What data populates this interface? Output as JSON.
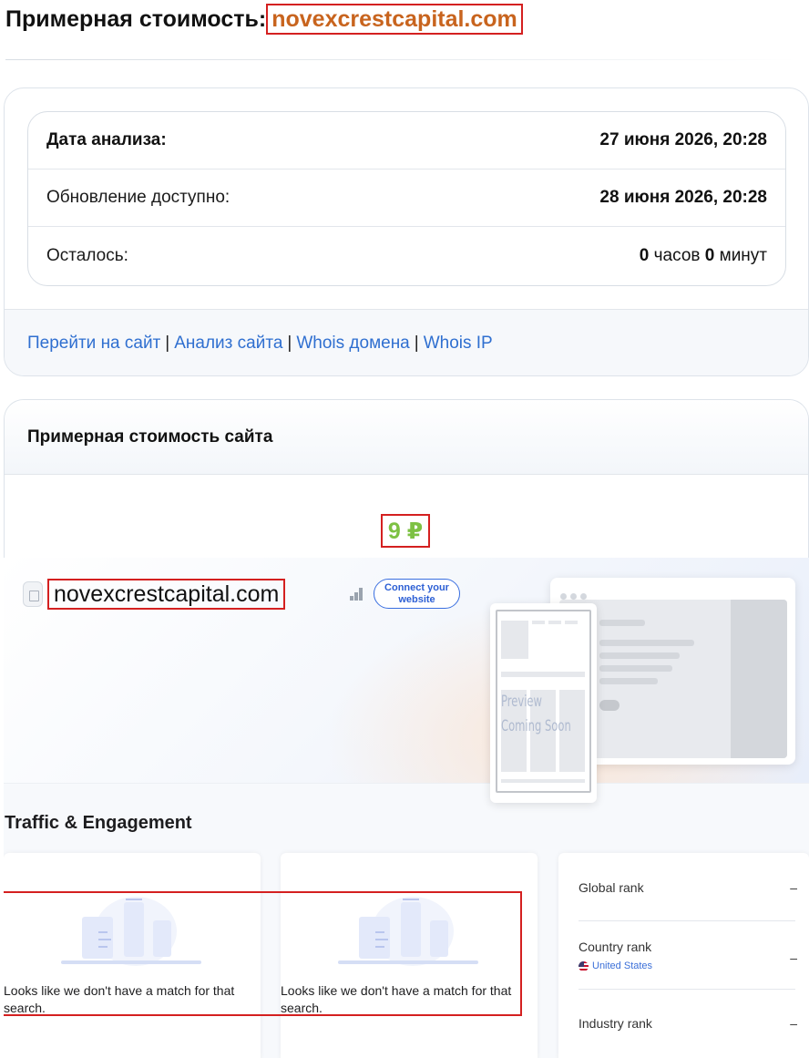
{
  "page_title": {
    "prefix": "Примерная стоимость:",
    "domain": "novexcrestcapital.com"
  },
  "analysis": {
    "rows": [
      {
        "label": "Дата анализа:",
        "value": "27 июня 2026, 20:28"
      },
      {
        "label": "Обновление доступно:",
        "value": "28 июня 2026, 20:28"
      }
    ],
    "remaining": {
      "label": "Осталось:",
      "hours": "0",
      "hours_unit": "часов",
      "minutes": "0",
      "minutes_unit": "минут"
    }
  },
  "links": [
    "Перейти на сайт",
    "Анализ сайта",
    "Whois домена",
    "Whois IP"
  ],
  "link_separator": "|",
  "value_card": {
    "title": "Примерная стоимость сайта",
    "price": "9 ₽"
  },
  "screenshot": {
    "domain": "novexcrestcapital.com",
    "connect_button": "Connect your website",
    "preview_line1": "Preview",
    "preview_line2": "Coming Soon",
    "traffic_title": "Traffic & Engagement",
    "no_match_message": "Looks like we don't have a match for that search.",
    "ranks": [
      {
        "label": "Global rank",
        "value": "–"
      },
      {
        "label": "Country rank",
        "value": "–",
        "country": "United States"
      },
      {
        "label": "Industry rank",
        "value": "–"
      }
    ]
  },
  "colors": {
    "domain_accent": "#c8641e",
    "price": "#7dc143",
    "link": "#2f6fd0",
    "highlight_box": "#d42020"
  }
}
